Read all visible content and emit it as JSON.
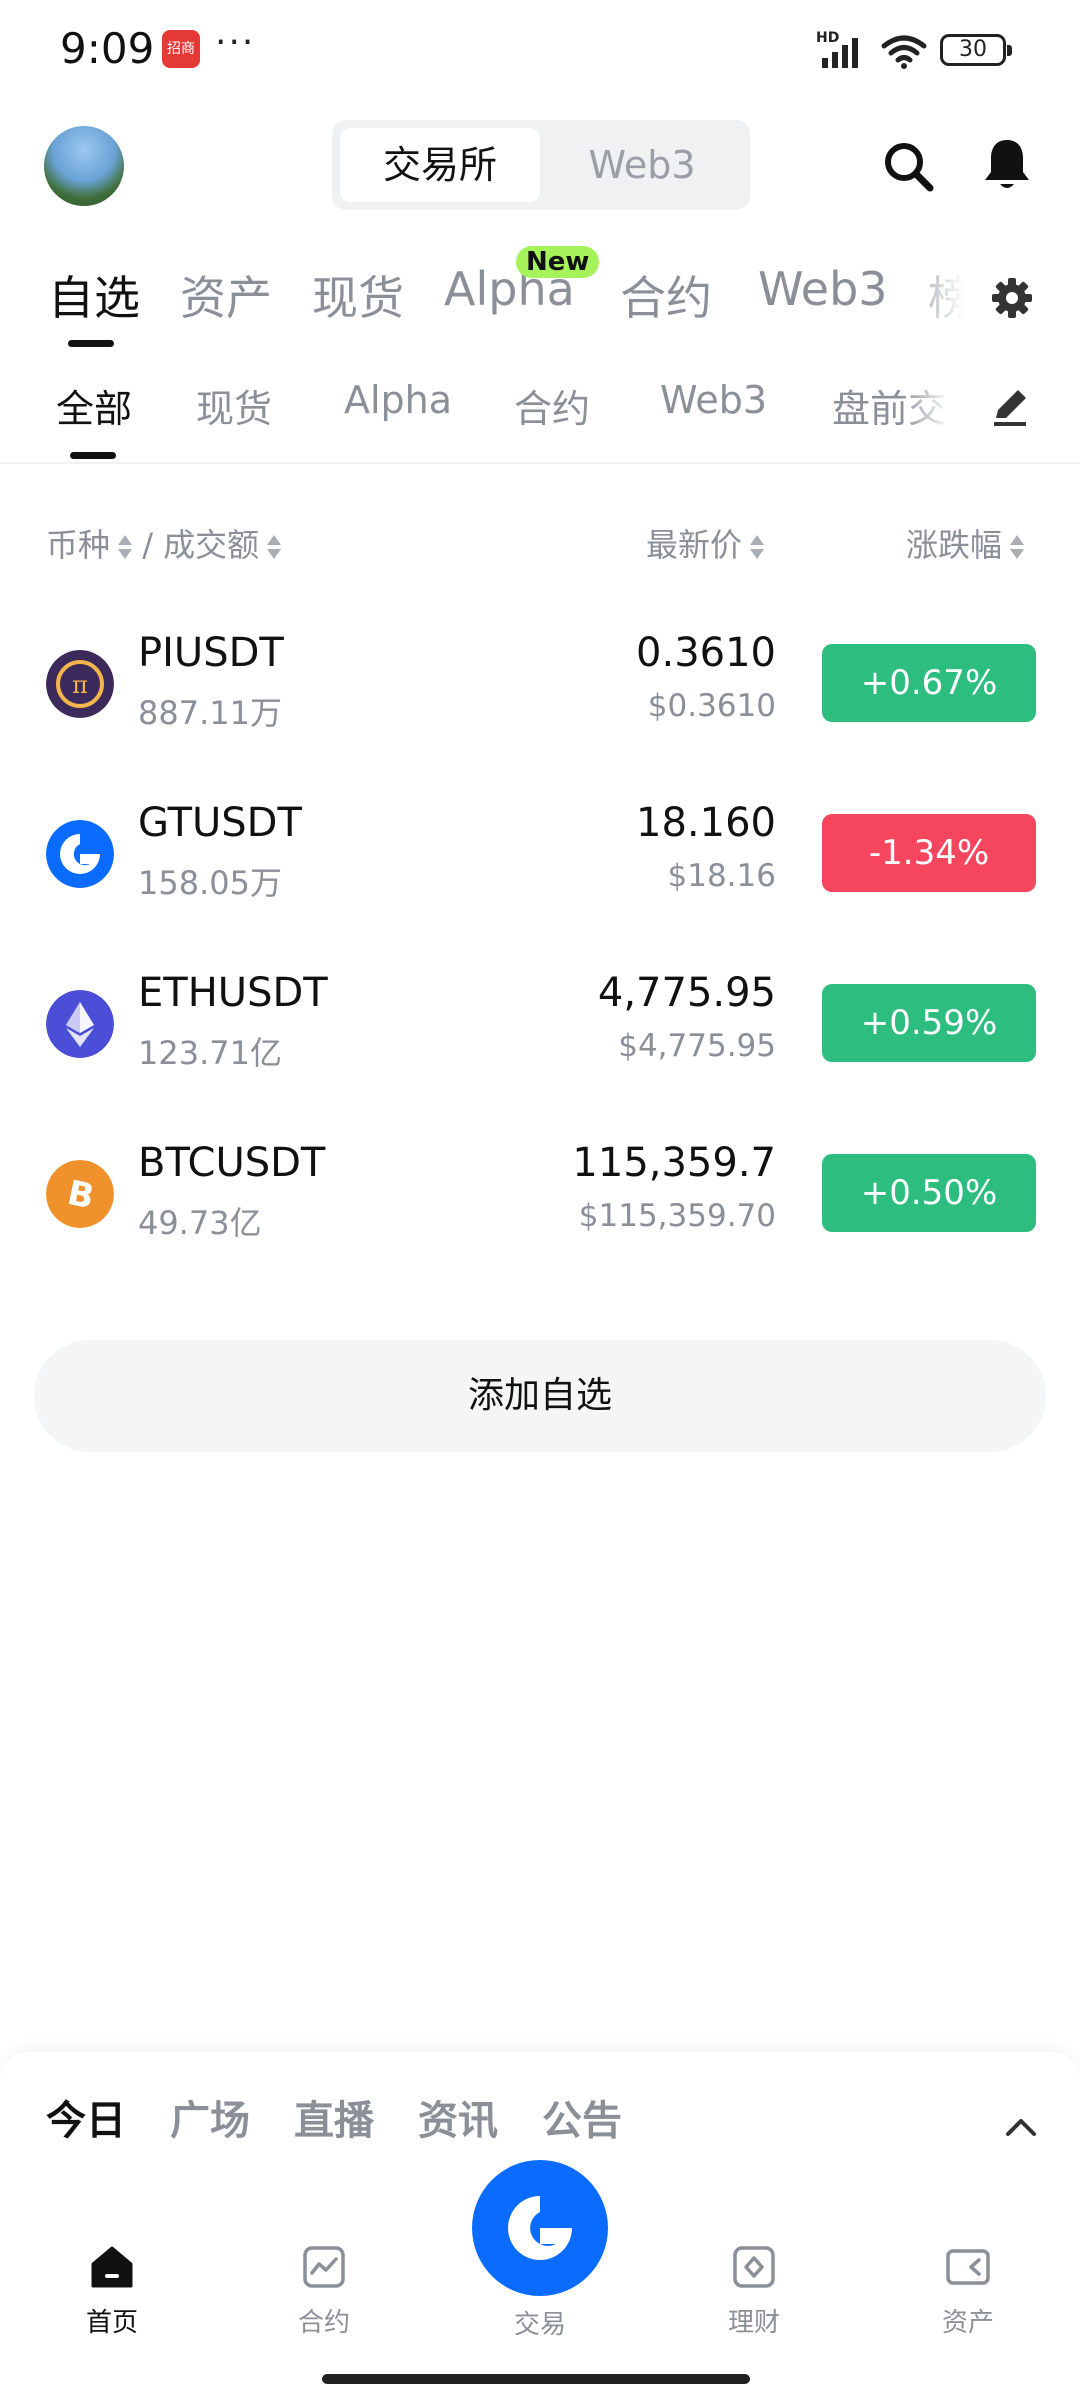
{
  "status_bar": {
    "time": "9:09",
    "app_badge": "招商",
    "more": "···",
    "network": "HD",
    "battery": "30"
  },
  "header": {
    "exchange_toggle": [
      "交易所",
      "Web3"
    ],
    "active_toggle": "交易所"
  },
  "main_tabs": {
    "items": [
      "自选",
      "资产",
      "现货",
      "Alpha",
      "合约",
      "Web3",
      "榜"
    ],
    "active": "自选",
    "new_badge": "New"
  },
  "sub_tabs": {
    "items": [
      "全部",
      "现货",
      "Alpha",
      "合约",
      "Web3",
      "盘前交"
    ],
    "active": "全部"
  },
  "columns": {
    "pair": "币种",
    "separator": "/",
    "volume": "成交额",
    "price": "最新价",
    "change": "涨跌幅"
  },
  "rows": [
    {
      "pair": "PIUSDT",
      "volume": "887.11万",
      "price": "0.3610",
      "fiat": "$0.3610",
      "change": "+0.67%",
      "direction": "up",
      "icon": "pi-coin-icon"
    },
    {
      "pair": "GTUSDT",
      "volume": "158.05万",
      "price": "18.160",
      "fiat": "$18.16",
      "change": "-1.34%",
      "direction": "down",
      "icon": "gt-coin-icon"
    },
    {
      "pair": "ETHUSDT",
      "volume": "123.71亿",
      "price": "4,775.95",
      "fiat": "$4,775.95",
      "change": "+0.59%",
      "direction": "up",
      "icon": "eth-coin-icon"
    },
    {
      "pair": "BTCUSDT",
      "volume": "49.73亿",
      "price": "115,359.7",
      "fiat": "$115,359.70",
      "change": "+0.50%",
      "direction": "up",
      "icon": "btc-coin-icon"
    }
  ],
  "add_watchlist": "添加自选",
  "feed_tabs": {
    "items": [
      "今日",
      "广场",
      "直播",
      "资讯",
      "公告"
    ],
    "active": "今日"
  },
  "bottom_nav": {
    "items": [
      "首页",
      "合约",
      "交易",
      "理财",
      "资产"
    ],
    "active": "首页"
  },
  "colors": {
    "up": "#2dbe7f",
    "down": "#f6465d",
    "brand": "#0a6cff",
    "new_badge": "#a6f25a"
  }
}
